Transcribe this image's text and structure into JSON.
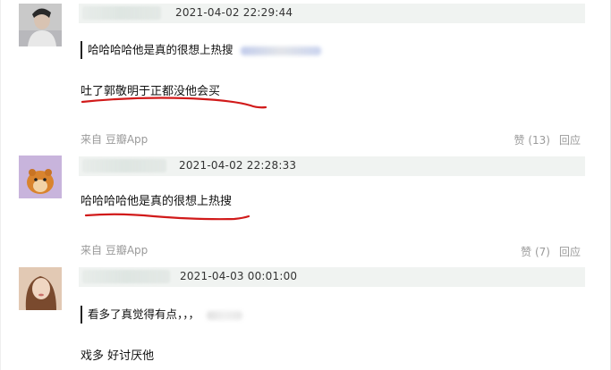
{
  "comments": [
    {
      "timestamp": "2021-04-02 22:29:44",
      "quote": "哈哈哈哈他是真的很想上热搜",
      "text": "吐了郭敬明于正都没他会买",
      "source": "来自 豆瓣App",
      "like_label": "赞 (13)",
      "reply_label": "回应",
      "avatar_icon": "person-portrait-avatar"
    },
    {
      "timestamp": "2021-04-02 22:28:33",
      "text": "哈哈哈哈他是真的很想上热搜",
      "source": "来自 豆瓣App",
      "like_label": "赞 (7)",
      "reply_label": "回应",
      "avatar_icon": "hamster-avatar"
    },
    {
      "timestamp": "2021-04-03 00:01:00",
      "quote": "看多了真觉得有点，，，",
      "text": "戏多 好讨厌他",
      "avatar_icon": "woman-portrait-avatar"
    }
  ],
  "colors": {
    "meta_bar": "#f0f3f1",
    "underline": "#d11a1a",
    "muted_text": "#9a9a9a"
  }
}
